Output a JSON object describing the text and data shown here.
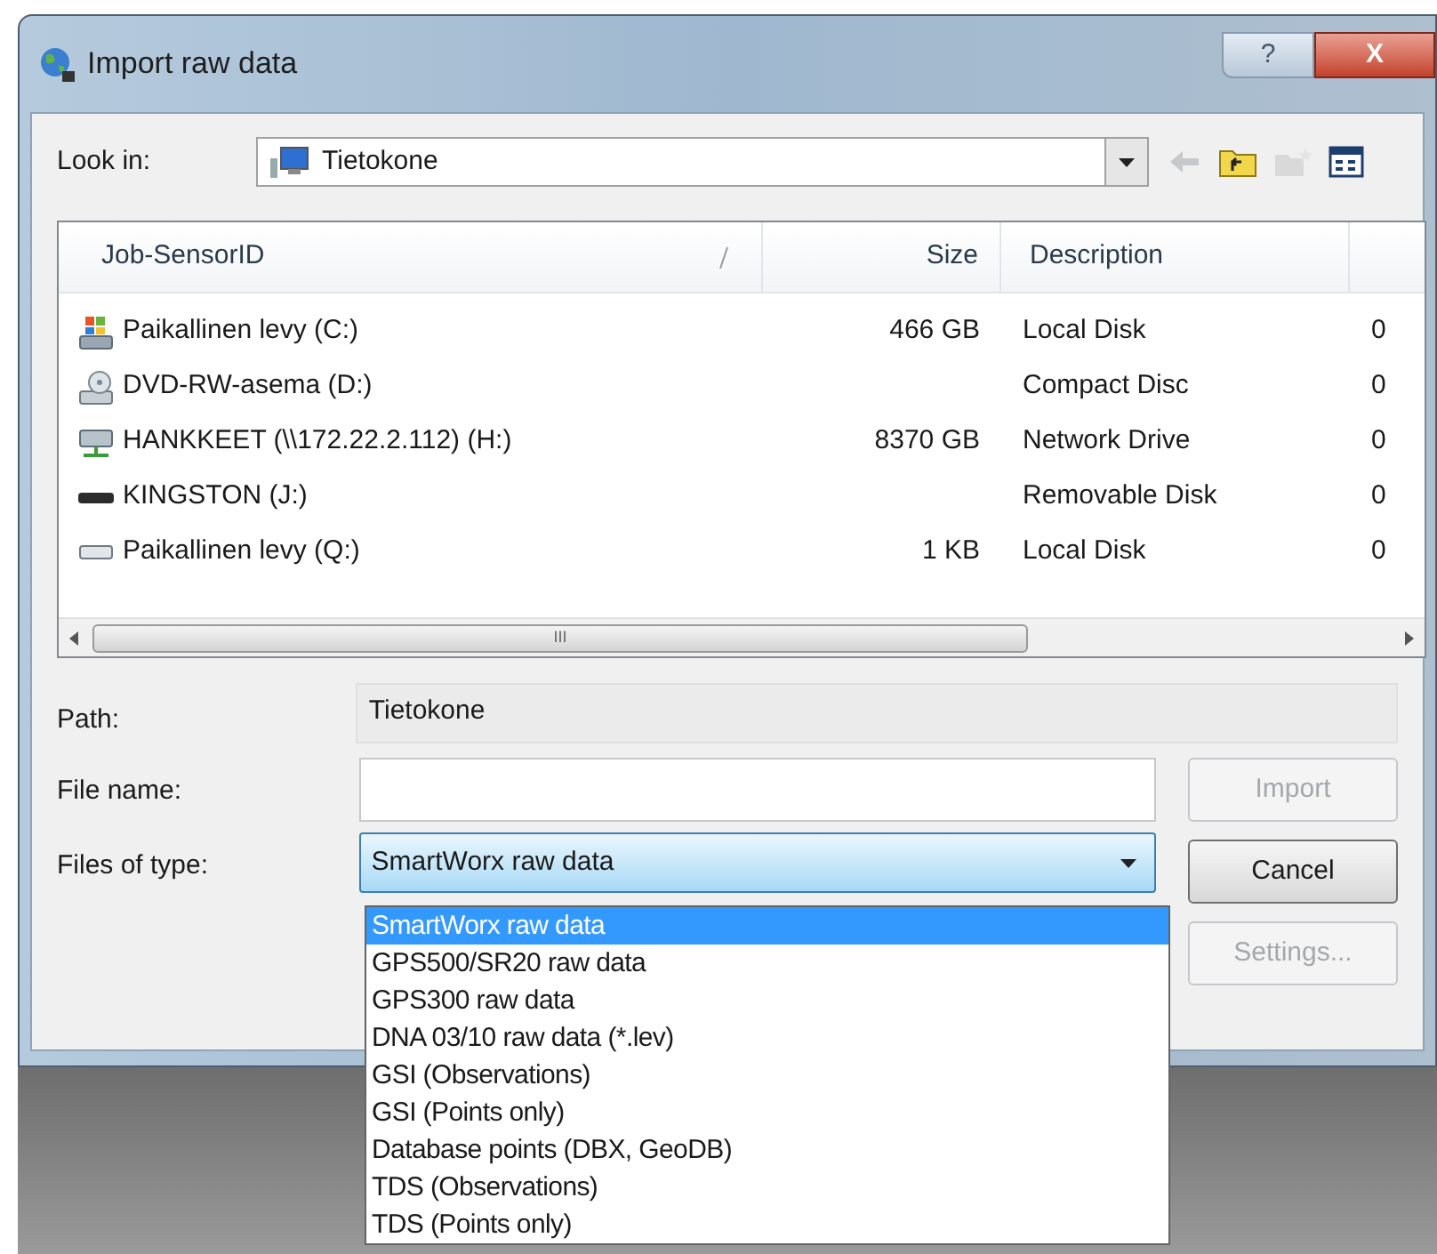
{
  "window": {
    "title": "Import raw data",
    "buttons": [
      {
        "kind": "help",
        "label": "?"
      },
      {
        "kind": "close",
        "label": "X"
      }
    ]
  },
  "look_in": {
    "label": "Look in:",
    "value": "Tietokone"
  },
  "toolbar": [
    {
      "kind": "back",
      "disabled": true
    },
    {
      "kind": "up",
      "disabled": false
    },
    {
      "kind": "new-folder",
      "disabled": true
    },
    {
      "kind": "view",
      "disabled": false
    }
  ],
  "list": {
    "columns": [
      "Job-SensorID",
      "Size",
      "Description"
    ],
    "rows": [
      {
        "kind": "system-drive",
        "name": "Paikallinen levy (C:)",
        "size": "466 GB",
        "description": "Local Disk",
        "column_4": "0"
      },
      {
        "kind": "dvd",
        "name": "DVD-RW-asema (D:)",
        "description": "Compact Disc",
        "column_4": "0"
      },
      {
        "kind": "network",
        "name": "HANKKEET (\\\\172.22.2.112) (H:)",
        "size": "8370 GB",
        "description": "Network Drive",
        "column_4": "0"
      },
      {
        "kind": "usb",
        "name": "KINGSTON (J:)",
        "description": "Removable Disk",
        "column_4": "0"
      },
      {
        "kind": "drive",
        "name": "Paikallinen levy (Q:)",
        "size": "1 KB",
        "description": "Local Disk",
        "column_4": "0"
      }
    ],
    "scroll_glyph": "III"
  },
  "path": {
    "label": "Path:",
    "value": "Tietokone"
  },
  "file_name": {
    "label": "File name:"
  },
  "files_of_type": {
    "label": "Files of type:",
    "value": "SmartWorx raw data",
    "expanded": true,
    "options": [
      {
        "label": "SmartWorx raw data",
        "selected": true
      },
      {
        "label": "GPS500/SR20 raw data",
        "selected": false
      },
      {
        "label": "GPS300 raw data",
        "selected": false
      },
      {
        "label": "DNA 03/10 raw data (*.lev)",
        "selected": false
      },
      {
        "label": "GSI (Observations)",
        "selected": false
      },
      {
        "label": "GSI (Points only)",
        "selected": false
      },
      {
        "label": "Database points (DBX, GeoDB)",
        "selected": false
      },
      {
        "label": "TDS (Observations)",
        "selected": false
      },
      {
        "label": "TDS (Points only)",
        "selected": false
      }
    ]
  },
  "buttons": [
    {
      "label": "Import",
      "disabled": true
    },
    {
      "label": "Cancel",
      "disabled": false
    },
    {
      "label": "Settings...",
      "disabled": true
    }
  ]
}
